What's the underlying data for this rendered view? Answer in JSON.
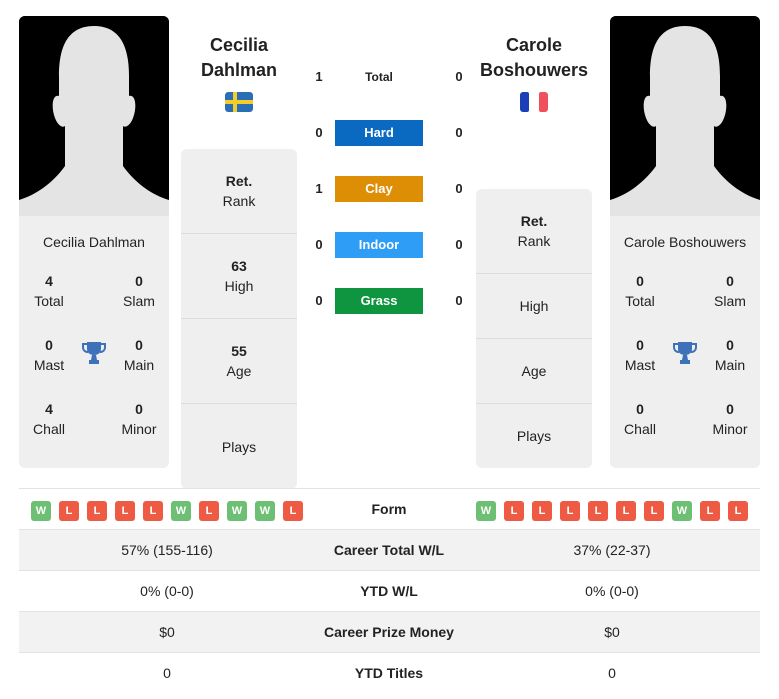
{
  "player1": {
    "name_line1": "Cecilia",
    "name_line2": "Dahlman",
    "full_name": "Cecilia Dahlman",
    "country": "Sweden",
    "flag_icon": "flag-sweden",
    "titles": {
      "total": "4",
      "total_label": "Total",
      "slam": "0",
      "slam_label": "Slam",
      "mast": "0",
      "mast_label": "Mast",
      "main": "0",
      "main_label": "Main",
      "chall": "4",
      "chall_label": "Chall",
      "minor": "0",
      "minor_label": "Minor"
    },
    "info": {
      "rank_value": "Ret.",
      "rank_label": "Rank",
      "high_value": "63",
      "high_label": "High",
      "age_value": "55",
      "age_label": "Age",
      "plays_value": "",
      "plays_label": "Plays"
    },
    "form": [
      "W",
      "L",
      "L",
      "L",
      "L",
      "W",
      "L",
      "W",
      "W",
      "L"
    ]
  },
  "player2": {
    "name_line1": "Carole",
    "name_line2": "Boshouwers",
    "full_name": "Carole Boshouwers",
    "country": "France",
    "flag_icon": "flag-france",
    "titles": {
      "total": "0",
      "total_label": "Total",
      "slam": "0",
      "slam_label": "Slam",
      "mast": "0",
      "mast_label": "Mast",
      "main": "0",
      "main_label": "Main",
      "chall": "0",
      "chall_label": "Chall",
      "minor": "0",
      "minor_label": "Minor"
    },
    "info": {
      "rank_value": "Ret.",
      "rank_label": "Rank",
      "high_value": "",
      "high_label": "High",
      "age_value": "",
      "age_label": "Age",
      "plays_value": "",
      "plays_label": "Plays"
    },
    "form": [
      "W",
      "L",
      "L",
      "L",
      "L",
      "L",
      "L",
      "W",
      "L",
      "L"
    ]
  },
  "h2h": [
    {
      "label": "Total",
      "p1": "1",
      "p2": "0",
      "color": ""
    },
    {
      "label": "Hard",
      "p1": "0",
      "p2": "0",
      "color": "#0a6ac2"
    },
    {
      "label": "Clay",
      "p1": "1",
      "p2": "0",
      "color": "#dd8e05"
    },
    {
      "label": "Indoor",
      "p1": "0",
      "p2": "0",
      "color": "#2e9df5"
    },
    {
      "label": "Grass",
      "p1": "0",
      "p2": "0",
      "color": "#0f9540"
    }
  ],
  "form_label": "Form",
  "stats": [
    {
      "label": "Career Total W/L",
      "p1": "57% (155-116)",
      "p2": "37% (22-37)"
    },
    {
      "label": "YTD W/L",
      "p1": "0% (0-0)",
      "p2": "0% (0-0)"
    },
    {
      "label": "Career Prize Money",
      "p1": "$0",
      "p2": "$0"
    },
    {
      "label": "YTD Titles",
      "p1": "0",
      "p2": "0"
    }
  ]
}
